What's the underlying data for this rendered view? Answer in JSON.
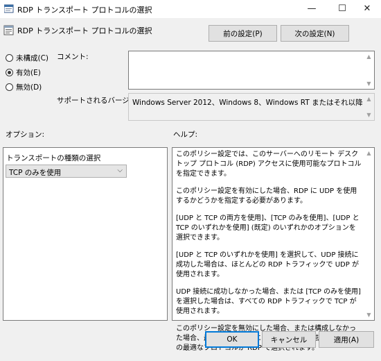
{
  "window": {
    "title": "RDP トランスポート プロトコルの選択",
    "minimize": "—",
    "maximize": "☐",
    "close": "✕"
  },
  "header": {
    "title": "RDP トランスポート プロトコルの選択"
  },
  "nav": {
    "prev_label": "前の設定(P)",
    "next_label": "次の設定(N)"
  },
  "state": {
    "options": [
      {
        "label": "未構成(C)",
        "selected": false
      },
      {
        "label": "有効(E)",
        "selected": true
      },
      {
        "label": "無効(D)",
        "selected": false
      }
    ]
  },
  "comment": {
    "label": "コメント:",
    "value": ""
  },
  "supported": {
    "label": "サポートされるバージョン:",
    "value": "Windows Server 2012、Windows 8、Windows RT またはそれ以降"
  },
  "options_section": {
    "label": "オプション:",
    "transport_label": "トランスポートの種類の選択",
    "transport_value": "TCP のみを使用"
  },
  "help_section": {
    "label": "ヘルプ:",
    "paragraphs": [
      "このポリシー設定では、このサーバーへのリモート デスクトップ プロトコル (RDP) アクセスに使用可能なプロトコルを指定できます。",
      "このポリシー設定を有効にした場合、RDP に UDP を使用するかどうかを指定する必要があります。",
      "[UDP と TCP の両方を使用]、[TCP のみを使用]、[UDP と TCP のいずれかを使用] (既定) のいずれかのオプションを選択できます。",
      "[UDP と TCP のいずれかを使用] を選択して、UDP 接続に成功した場合は、ほとんどの RDP トラフィックで UDP が使用されます。",
      "UDP 接続に成功しなかった場合、または [TCP のみを使用] を選択した場合は、すべての RDP トラフィックで TCP が使用されます。",
      "このポリシー設定を無効にした場合、または構成しなかった場合、最適なユーザー エクスペリエンスを提供するための最適なプロトコルが RDP で選択されます。"
    ]
  },
  "footer": {
    "ok_label": "OK",
    "cancel_label": "キャンセル",
    "apply_label": "適用(A)"
  }
}
